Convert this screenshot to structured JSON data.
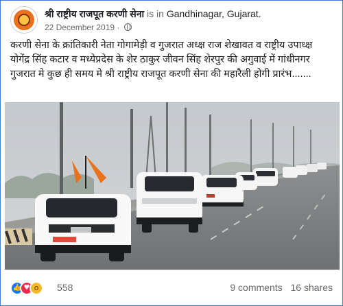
{
  "post": {
    "page_name": "श्री राष्ट्रीय राजपूत करणी सेना",
    "is_in": "is in",
    "location": "Gandhinagar, Gujarat.",
    "date": "22 December 2019",
    "separator": "·",
    "privacy_icon": "globe-icon",
    "text": "करणी सेना के क्रांतिकारी नेता गोगामेड़ी व गुजरात अध्क्ष राज शेखावत व राष्ट्रीय उपाध्क्ष योगेंद्र सिंह कटार व मध्येप्रदेस के शेर ठाकुर जीवन सिंह शेरपुर की अगुवाई में गांधीनगर गुजरात मे कुछ ही समय मे श्री राष्ट्रीय राजपूत करणी सेना की महारैली होगी प्रारंभ......."
  },
  "footer": {
    "reaction_icons": [
      "like-icon",
      "love-icon",
      "wow-icon"
    ],
    "reaction_count": "558",
    "comments": "9 comments",
    "shares": "16 shares"
  },
  "colors": {
    "frame_border": "#3b7fd4",
    "text_primary": "#1c1e21",
    "text_secondary": "#65676b",
    "like": "#1877f2",
    "love": "#f02849",
    "wow": "#f7b928",
    "flag_saffron": "#e8731c"
  }
}
